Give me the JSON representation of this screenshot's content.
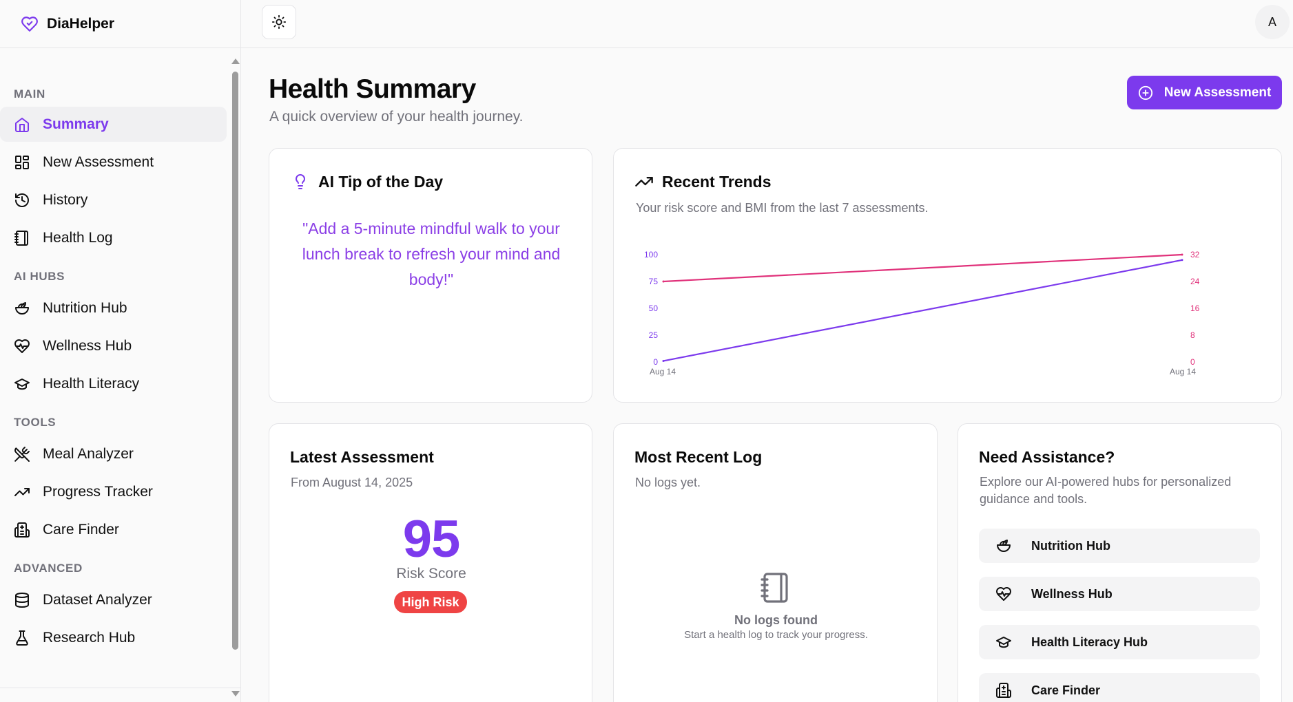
{
  "app": {
    "name": "DiaHelper"
  },
  "sidebar": {
    "sections": [
      {
        "title": "MAIN",
        "items": [
          {
            "label": "Summary",
            "icon": "home-icon",
            "active": true
          },
          {
            "label": "New Assessment",
            "icon": "dashboard-grid-icon"
          },
          {
            "label": "History",
            "icon": "history-icon"
          },
          {
            "label": "Health Log",
            "icon": "notebook-icon"
          }
        ]
      },
      {
        "title": "AI HUBS",
        "items": [
          {
            "label": "Nutrition Hub",
            "icon": "salad-icon"
          },
          {
            "label": "Wellness Hub",
            "icon": "heart-pulse-icon"
          },
          {
            "label": "Health Literacy",
            "icon": "graduation-cap-icon"
          }
        ]
      },
      {
        "title": "TOOLS",
        "items": [
          {
            "label": "Meal Analyzer",
            "icon": "utensils-crossed-icon"
          },
          {
            "label": "Progress Tracker",
            "icon": "trending-up-icon"
          },
          {
            "label": "Care Finder",
            "icon": "hospital-icon"
          }
        ]
      },
      {
        "title": "ADVANCED",
        "items": [
          {
            "label": "Dataset Analyzer",
            "icon": "database-icon"
          },
          {
            "label": "Research Hub",
            "icon": "flask-icon"
          }
        ]
      }
    ]
  },
  "header": {
    "avatar_initial": "A",
    "theme_icon": "sun-icon"
  },
  "page": {
    "title": "Health Summary",
    "subtitle": "A quick overview of your health journey.",
    "primary_button": "New Assessment"
  },
  "tip": {
    "title": "AI Tip of the Day",
    "text": "\"Add a 5-minute mindful walk to your lunch break to refresh your mind and body!\""
  },
  "trends": {
    "title": "Recent Trends",
    "description": "Your risk score and BMI from the last 7 assessments."
  },
  "chart_data": {
    "type": "line",
    "title": "",
    "x": [
      "Aug 14",
      "Aug 14"
    ],
    "series": [
      {
        "values": [
          1,
          95
        ],
        "axis": "left",
        "color": "#7c3aed"
      },
      {
        "values": [
          24,
          32
        ],
        "axis": "right",
        "color": "#e0317a"
      }
    ],
    "ylim_left": [
      0,
      100
    ],
    "yticks_left": [
      "0",
      "25",
      "50",
      "75",
      "100"
    ],
    "ylim_right": [
      0,
      32
    ],
    "yticks_right": [
      "0",
      "8",
      "16",
      "24",
      "32"
    ],
    "grid": false,
    "legend": "none"
  },
  "latest": {
    "title": "Latest Assessment",
    "subtitle": "From August 14, 2025",
    "score": "95",
    "score_label": "Risk Score",
    "risk_label": "High Risk"
  },
  "log": {
    "title": "Most Recent Log",
    "subtitle": "No logs yet.",
    "empty_title": "No logs found",
    "empty_text": "Start a health log to track your progress."
  },
  "assist": {
    "title": "Need Assistance?",
    "description": "Explore our AI-powered hubs for personalized guidance and tools.",
    "buttons": [
      {
        "label": "Nutrition Hub",
        "icon": "salad-icon"
      },
      {
        "label": "Wellness Hub",
        "icon": "heart-pulse-icon"
      },
      {
        "label": "Health Literacy Hub",
        "icon": "graduation-cap-icon"
      },
      {
        "label": "Care Finder",
        "icon": "hospital-icon"
      }
    ]
  },
  "colors": {
    "accent": "#7c3aed",
    "bmi_line": "#e0317a",
    "danger": "#ef4444",
    "muted_text": "#71717a"
  }
}
